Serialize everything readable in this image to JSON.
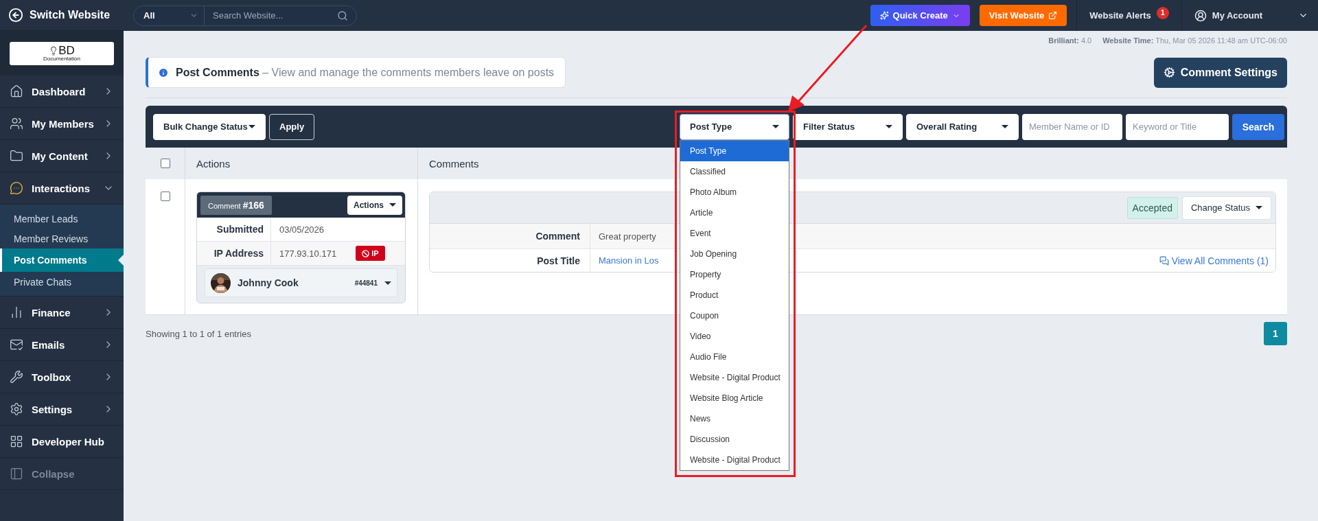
{
  "topbar": {
    "switch_label": "Switch Website",
    "search_scope": "All",
    "search_placeholder": "Search Website...",
    "quick_create": "Quick Create",
    "visit_website": "Visit Website",
    "alerts_label": "Website Alerts",
    "alerts_count": "1",
    "account": "My Account"
  },
  "sidebar": {
    "logo_text": "BD",
    "logo_caption": "Documentation",
    "items": [
      {
        "label": "Dashboard",
        "kind": "menu",
        "expanded": false
      },
      {
        "label": "My Members",
        "kind": "menu",
        "expanded": false
      },
      {
        "label": "My Content",
        "kind": "menu",
        "expanded": false
      },
      {
        "label": "Interactions",
        "kind": "menu",
        "expanded": true,
        "children": [
          {
            "label": "Member Leads",
            "selected": false
          },
          {
            "label": "Member Reviews",
            "selected": false
          },
          {
            "label": "Post Comments",
            "selected": true
          },
          {
            "label": "Private Chats",
            "selected": false
          }
        ]
      },
      {
        "label": "Finance",
        "kind": "menu",
        "expanded": false
      },
      {
        "label": "Emails",
        "kind": "menu",
        "expanded": false
      },
      {
        "label": "Toolbox",
        "kind": "menu",
        "expanded": false
      },
      {
        "label": "Settings",
        "kind": "menu",
        "expanded": false
      },
      {
        "label": "Developer Hub",
        "kind": "link"
      },
      {
        "label": "Collapse",
        "kind": "collapse"
      }
    ]
  },
  "info": [
    {
      "label": "Brilliant:",
      "value": "4.0"
    },
    {
      "label": "Website Time:",
      "value": "Thu, Mar 05 2026 11:48 am UTC-06:00"
    }
  ],
  "page_header": {
    "title": "Post Comments",
    "subtitle": "– View and manage the comments members leave on posts",
    "settings_button": "Comment Settings"
  },
  "toolbar": {
    "bulk": "Bulk Change Status",
    "apply": "Apply",
    "search": "Search",
    "filters": [
      {
        "kind": "select",
        "label": "Post Type",
        "options": [
          {
            "label": "Post Type",
            "selected": true
          },
          {
            "label": "Classified",
            "selected": false
          },
          {
            "label": "Photo Album",
            "selected": false
          },
          {
            "label": "Article",
            "selected": false
          },
          {
            "label": "Event",
            "selected": false
          },
          {
            "label": "Job Opening",
            "selected": false
          },
          {
            "label": "Property",
            "selected": false
          },
          {
            "label": "Product",
            "selected": false
          },
          {
            "label": "Coupon",
            "selected": false
          },
          {
            "label": "Video",
            "selected": false
          },
          {
            "label": "Audio File",
            "selected": false
          },
          {
            "label": "Website - Digital Product",
            "selected": false
          },
          {
            "label": "Website Blog Article",
            "selected": false
          },
          {
            "label": "News",
            "selected": false
          },
          {
            "label": "Discussion",
            "selected": false
          },
          {
            "label": "Website - Digital Product",
            "selected": false
          }
        ]
      },
      {
        "kind": "select",
        "label": "Filter Status"
      },
      {
        "kind": "select",
        "label": "Overall Rating"
      },
      {
        "kind": "input",
        "placeholder": "Member Name or ID"
      },
      {
        "kind": "input",
        "placeholder": "Keyword or Title"
      }
    ]
  },
  "table": {
    "header_checked": false,
    "columns": [
      "Actions",
      "Comments"
    ],
    "rows": [
      {
        "checked": false,
        "card": {
          "badge": "Comment **#166**",
          "actions": "Actions",
          "fields": [
            {
              "label": "Submitted",
              "value": "03/05/2026"
            },
            {
              "label": "IP Address",
              "value": "177.93.10.171",
              "action": "IP"
            }
          ],
          "member_name": "Johnny Cook",
          "member_id": "#44841"
        },
        "details": {
          "status": "Accepted",
          "change_status": "Change Status",
          "fields": [
            {
              "label": "Comment",
              "value": "Great property",
              "kind": "text"
            },
            {
              "label": "Post Title",
              "value": "Mansion in Los",
              "kind": "link"
            }
          ],
          "view_all": "View All Comments (1)"
        }
      }
    ]
  },
  "footer": {
    "summary": "Showing 1 to 1 of 1 entries",
    "pages": [
      {
        "label": "1",
        "selected": true
      }
    ]
  }
}
